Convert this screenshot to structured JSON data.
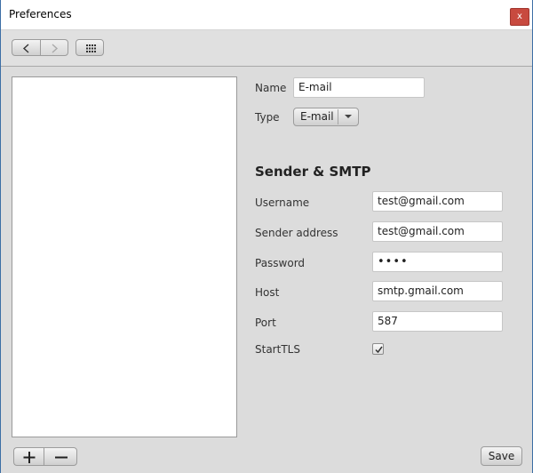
{
  "window": {
    "title": "Preferences",
    "close_label": "x"
  },
  "toolbar": {
    "back_icon": "chevron-left-icon",
    "forward_icon": "chevron-right-icon",
    "grid_icon": "grid-icon"
  },
  "form": {
    "name_label": "Name",
    "name_value": "E-mail",
    "type_label": "Type",
    "type_value": "E-mail"
  },
  "smtp": {
    "title": "Sender & SMTP",
    "username_label": "Username",
    "username_value": "test@gmail.com",
    "sender_label": "Sender address",
    "sender_value": "test@gmail.com",
    "password_label": "Password",
    "password_value": "••••",
    "host_label": "Host",
    "host_value": "smtp.gmail.com",
    "port_label": "Port",
    "port_value": "587",
    "starttls_label": "StartTLS",
    "starttls_checked": true
  },
  "footer": {
    "save_label": "Save"
  }
}
